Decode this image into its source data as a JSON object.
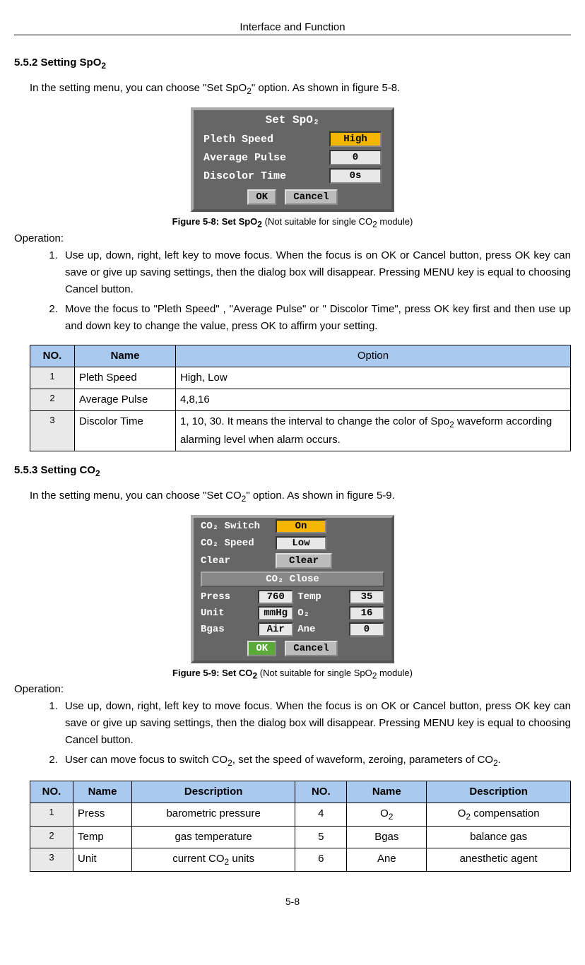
{
  "header": {
    "title": "Interface and Function"
  },
  "section1": {
    "heading_prefix": "5.5.2 Setting SpO",
    "heading_sub": "2",
    "intro_pre": "In the setting menu, you can choose \"Set SpO",
    "intro_sub": "2",
    "intro_post": "\" option. As shown in figure 5-8.",
    "dialog": {
      "title": "Set SpO₂",
      "rows": [
        {
          "label": "Pleth Speed",
          "value": "High",
          "highlight": "true"
        },
        {
          "label": "Average Pulse",
          "value": "0",
          "highlight": "false"
        },
        {
          "label": "Discolor Time",
          "value": "0s",
          "highlight": "false"
        }
      ],
      "ok": "OK",
      "cancel": "Cancel"
    },
    "caption_bold_pre": "Figure 5-8: Set SpO",
    "caption_bold_sub": "2",
    "caption_rest_pre": "(Not suitable for single CO",
    "caption_rest_sub": "2",
    "caption_rest_post": " module)",
    "operation_label": "Operation:",
    "op_items": [
      "Use up, down, right, left key to move focus. When the focus is on OK or Cancel button, press OK key can save or give up saving settings, then the dialog box will disappear. Pressing MENU key is equal to choosing Cancel button.",
      "Move the focus to \"Pleth Speed\" , \"Average Pulse\" or \" Discolor Time\", press OK key first and then use up and down key to change the value, press OK to affirm your setting."
    ],
    "table": {
      "headers": {
        "no": "NO.",
        "name": "Name",
        "option": "Option"
      },
      "rows": [
        {
          "no": "1",
          "name": "Pleth Speed",
          "option": "High, Low"
        },
        {
          "no": "2",
          "name": "Average Pulse",
          "option": "4,8,16"
        },
        {
          "no": "3",
          "name": "Discolor Time",
          "option_pre": "1, 10, 30. It means the interval to change the color of Spo",
          "option_sub": "2",
          "option_post": " waveform according alarming level when alarm occurs."
        }
      ]
    }
  },
  "section2": {
    "heading_prefix": "5.5.3 Setting CO",
    "heading_sub": "2",
    "intro_pre": "In the setting menu, you can choose \"Set CO",
    "intro_sub": "2",
    "intro_post": "\" option. As shown in figure 5-9.",
    "dialog": {
      "r1_label": "CO₂ Switch",
      "r1_val": "On",
      "r2_label": "CO₂ Speed",
      "r2_val": "Low",
      "r3_label": "Clear",
      "r3_btn": "Clear",
      "section_bar": "CO₂ Close",
      "grid": {
        "press_l": "Press",
        "press_v": "760",
        "temp_l": "Temp",
        "temp_v": "35",
        "unit_l": "Unit",
        "unit_v": "mmHg",
        "o2_l": "O₂",
        "o2_v": "16",
        "bgas_l": "Bgas",
        "bgas_v": "Air",
        "ane_l": "Ane",
        "ane_v": "0"
      },
      "ok": "OK",
      "cancel": "Cancel"
    },
    "caption_bold_pre": "Figure 5-9: Set CO",
    "caption_bold_sub": "2",
    "caption_rest_pre": "(Not suitable for single SpO",
    "caption_rest_sub": "2",
    "caption_rest_post": " module)",
    "operation_label": "Operation:",
    "op_item1": "Use up, down, right, left key to move focus. When the focus is on OK or Cancel button, press OK key can save or give up saving settings, then the dialog box will disappear. Pressing MENU key is equal to choosing Cancel button.",
    "op_item2_pre": "User can move focus to switch CO",
    "op_item2_sub": "2",
    "op_item2_mid": ", set the speed of waveform, zeroing, parameters of CO",
    "op_item2_post": ".",
    "table": {
      "headers": {
        "no": "NO.",
        "name": "Name",
        "desc": "Description"
      },
      "rows": [
        {
          "no": "1",
          "name": "Press",
          "desc": "barometric pressure",
          "no2": "4",
          "name2_pre": "O",
          "name2_sub": "2",
          "desc2_pre": "O",
          "desc2_sub": "2",
          "desc2_post": " compensation"
        },
        {
          "no": "2",
          "name": "Temp",
          "desc": "gas temperature",
          "no2": "5",
          "name2": "Bgas",
          "desc2": "balance gas"
        },
        {
          "no": "3",
          "name": "Unit",
          "desc_pre": "current CO",
          "desc_sub": "2",
          "desc_post": " units",
          "no2": "6",
          "name2": "Ane",
          "desc2": "anesthetic agent"
        }
      ]
    }
  },
  "footer": {
    "page": "5-8"
  }
}
